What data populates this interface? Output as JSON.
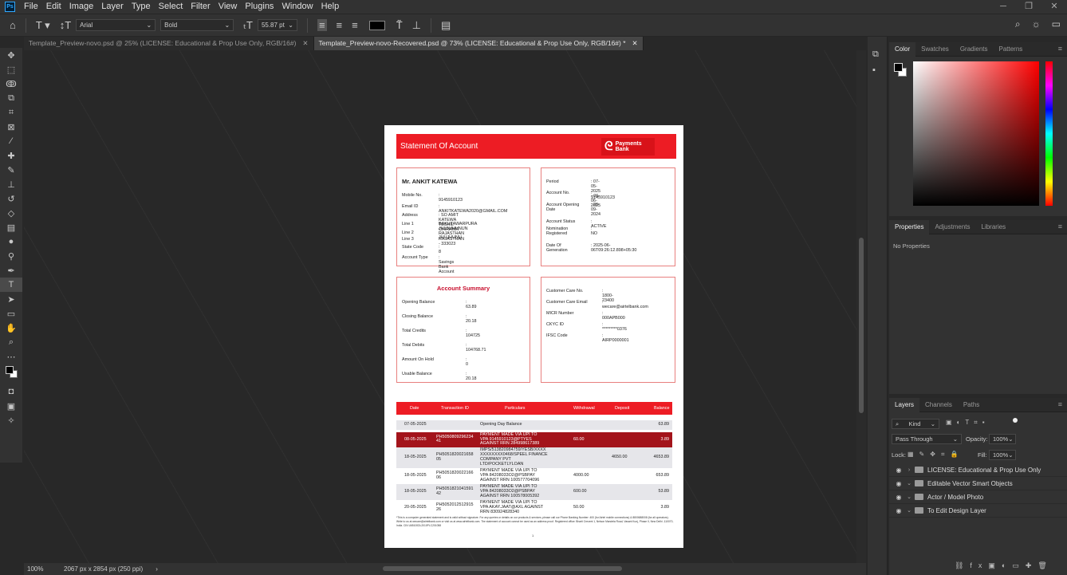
{
  "menubar": {
    "logo": "Ps",
    "items": [
      "File",
      "Edit",
      "Image",
      "Layer",
      "Type",
      "Select",
      "Filter",
      "View",
      "Plugins",
      "Window",
      "Help"
    ]
  },
  "options": {
    "font_family": "Arial",
    "font_style": "Bold",
    "font_size": "55.87 pt"
  },
  "tabs": [
    {
      "label": "Template_Preview-novo.psd @ 25% (LICENSE: Educational & Prop Use Only, RGB/16#)",
      "active": false
    },
    {
      "label": "Template_Preview-novo-Recovered.psd @ 73% (LICENSE: Educational & Prop Use Only, RGB/16#) *",
      "active": true
    }
  ],
  "status": {
    "zoom": "100%",
    "doc_info": "2067 px x 2854 px (250 ppi)"
  },
  "panels": {
    "color_tabs": [
      "Color",
      "Swatches",
      "Gradients",
      "Patterns"
    ],
    "properties_tabs": [
      "Properties",
      "Adjustments",
      "Libraries"
    ],
    "properties_empty": "No Properties",
    "layers_tabs": [
      "Layers",
      "Channels",
      "Paths"
    ],
    "layers_kind": "Kind",
    "blend_mode": "Pass Through",
    "opacity_label": "Opacity:",
    "opacity": "100%",
    "lock_label": "Lock:",
    "fill_label": "Fill:",
    "fill": "100%",
    "layers": [
      "LICENSE: Educational & Prop Use Only",
      "Editable Vector Smart Objects",
      "Actor / Model Photo",
      "To Edit Design Layer"
    ]
  },
  "document": {
    "title": "Statement Of Account",
    "logo_text": "Payments\nBank",
    "customer": {
      "name": "Mr. ANKIT KATEWA",
      "rows": [
        {
          "label": "Mobile No.",
          "value": ": 9145910123"
        },
        {
          "label": "Email ID",
          "value": ": ANKITKATEWA2020@GMAIL.COM"
        },
        {
          "label": "Address",
          "value": ": SO AMIT KATEWA TESHIL CHIRAWA"
        },
        {
          "label": "Line 1",
          "value": "BAKHTAWARPURA JHUNJHUNUN\nRAJASTHAN"
        },
        {
          "label": "Line 2",
          "value": ": JHUJHUNU"
        },
        {
          "label": "Line 3",
          "value": "RAJASTHAN - 333023"
        },
        {
          "label": "State Code",
          "value": ": 8"
        },
        {
          "label": "Account Type",
          "value": ": Savings Bank Account"
        }
      ]
    },
    "account": [
      {
        "label": "Period",
        "value": ": 07-05-2025 - 06-06-2025"
      },
      {
        "label": "Account No.",
        "value": ": 9145910123"
      },
      {
        "label": "Account Opening\nDate",
        "value": ": 26-09-2024"
      },
      {
        "label": "Account Status",
        "value": ": ACTIVE"
      },
      {
        "label": "Nomination\nRegistered",
        "value": ": NO"
      },
      {
        "label": "Date Of\nGeneration",
        "value": ": 2025-06-06T09:26:12.898+05:30"
      }
    ],
    "summary": {
      "title": "Account Summary",
      "rows": [
        {
          "label": "Opening Balance",
          "value": ": 63.89"
        },
        {
          "label": "Closing Balance",
          "value": ": 20.18"
        },
        {
          "label": "Total Credits",
          "value": ": 104725"
        },
        {
          "label": "Total Debits",
          "value": ": 104768.71"
        },
        {
          "label": "Amount On Hold",
          "value": ": 0"
        },
        {
          "label": "Usable Balance",
          "value": ": 20.18"
        }
      ]
    },
    "care": [
      {
        "label": "Customer Care No.",
        "value": ": 1800-23400"
      },
      {
        "label": "Customer Care Email",
        "value": ": wecare@airtelbank.com"
      },
      {
        "label": "MICR Number",
        "value": ": 000APB000"
      },
      {
        "label": "CKYC ID",
        "value": ": *********0376"
      },
      {
        "label": "IFSC Code",
        "value": ": AIRP0000001"
      }
    ],
    "table": {
      "headers": [
        "Date",
        "Transaction ID",
        "Particulars",
        "Withdrawal",
        "Deposit",
        "Balance"
      ],
      "rows": [
        {
          "date": "07-05-2025",
          "txn": "",
          "particulars": "Opening Day Balance",
          "withdrawal": "",
          "deposit": "",
          "balance": "63.89"
        },
        {
          "date": "08-05-2025",
          "txn": "PH5050809296234\n41",
          "particulars": "PAYMENT MADE VIA UPI TO\nVPA 9145910123@PTYES\nAGAINST RRN 284998617389",
          "withdrawal": "60.00",
          "deposit": "",
          "balance": "3.89"
        },
        {
          "date": "18-05-2025",
          "txn": "PH5051820021658\n05",
          "particulars": "IMPS/513820984759/YESB/XXXX\nXXXXXXXX0468/SPEEL FINANCE\nCOMPANY PVT\nLTD/POCKETLYLOAN",
          "withdrawal": "",
          "deposit": "4650.00",
          "balance": "4653.89"
        },
        {
          "date": "18-05-2025",
          "txn": "PH5051820022166\n06",
          "particulars": "PAYMENT MADE VIA UPI TO\nVPA 84208033O2@PSBPAY\nAGAINST RRN 100577704096",
          "withdrawal": "4000.00",
          "deposit": "",
          "balance": "653.89"
        },
        {
          "date": "18-05-2025",
          "txn": "PH5051821041591\n42",
          "particulars": "PAYMENT MADE VIA UPI TO\nVPA 84208033O2@PSBPAY\nAGAINST RRN 100578005392",
          "withdrawal": "600.00",
          "deposit": "",
          "balance": "53.89"
        },
        {
          "date": "20-05-2025",
          "txn": "PH5052012512915\n26",
          "particulars": "PAYMENT MADE VIA UPI TO\nVPA AKAY.JAAT@AXL AGAINST\nRRN 830924828340",
          "withdrawal": "50.00",
          "deposit": "",
          "balance": "3.89"
        }
      ]
    },
    "footnote": "*This is a computer generated statement and is valid without signature. For any queries or details on our products & services, please call our Phone Banking Number: 400 (for Airtel mobile connections) & 8800688008 (for all operators). Write to us at wecare@airtelbank.com or visit us at www.airtelbank.com. The statement of account cannot be used as an address proof. Registered office: Bharti Crecent 1, Nelson Mandela Road, Vasant Kunj, Phase II, New Delhi -110070, India. CIN U65100DL2010PLC201058",
    "page": "1"
  }
}
